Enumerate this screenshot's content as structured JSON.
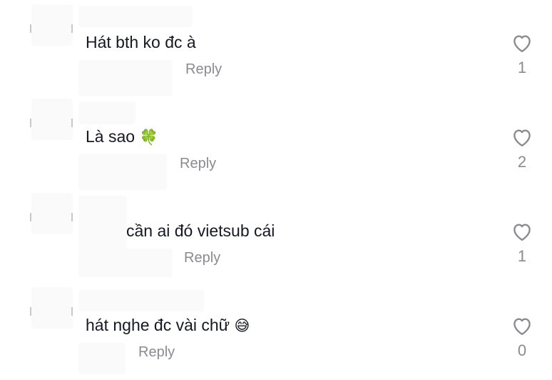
{
  "comments": [
    {
      "text": "Hát bth ko đc à",
      "emoji": "",
      "reply_label": "Reply",
      "likes": "1"
    },
    {
      "text": "Là sao",
      "emoji": "🍀",
      "reply_label": "Reply",
      "likes": "2"
    },
    {
      "text": "cần ai đó vietsub cái",
      "emoji": "",
      "reply_label": "Reply",
      "likes": "1"
    },
    {
      "text": "hát nghe đc vài chữ",
      "emoji": "😅",
      "reply_label": "Reply",
      "likes": "0"
    }
  ],
  "icons": {
    "like": "heart-outline-icon"
  },
  "colors": {
    "text": "#161823",
    "muted": "#8a8b91",
    "icon": "#8a8b91"
  }
}
